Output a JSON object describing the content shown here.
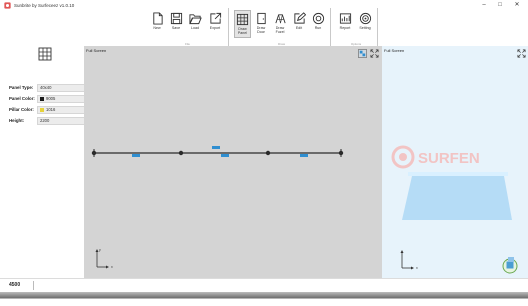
{
  "window": {
    "title": "Sunbrite by Surfeceez v1.0.10"
  },
  "ribbon": {
    "groups": [
      {
        "caption": "File",
        "buttons": [
          {
            "label": "New",
            "icon": "new-file-icon"
          },
          {
            "label": "Save",
            "icon": "save-icon"
          },
          {
            "label": "Load",
            "icon": "folder-open-icon"
          },
          {
            "label": "Export",
            "icon": "export-icon"
          }
        ]
      },
      {
        "caption": "Draw",
        "buttons": [
          {
            "label": "Draw Panel",
            "icon": "grid-panel-icon",
            "active": true
          },
          {
            "label": "Draw Door",
            "icon": "door-icon"
          },
          {
            "label": "Draw Fuzel",
            "icon": "fuzel-icon"
          },
          {
            "label": "Edit",
            "icon": "edit-icon"
          },
          {
            "label": "Run",
            "icon": "run-icon"
          }
        ]
      },
      {
        "caption": "Options",
        "buttons": [
          {
            "label": "Report",
            "icon": "report-icon"
          },
          {
            "label": "Setting",
            "icon": "settings-icon"
          }
        ]
      }
    ]
  },
  "properties": {
    "panel_type": {
      "label": "Panel Type:",
      "value": "40x40"
    },
    "panel_color": {
      "label": "Panel Color:",
      "value": "9005",
      "swatch": "#1a1a1a"
    },
    "pillar_color": {
      "label": "Pillar Color:",
      "value": "1016",
      "swatch": "#e6d23a"
    },
    "height": {
      "label": "Height:",
      "value": "2200"
    }
  },
  "main_view": {
    "header": "Full Screen"
  },
  "view_3d": {
    "header": "Full Screen",
    "watermark": "SURFEN"
  },
  "status": {
    "value": "4500"
  },
  "colors": {
    "plan_background": "#d4d4d4",
    "wall_line": "#2a2a2a",
    "panel_marker": "#2f8ed0",
    "model_blue": "#9fd0f2",
    "axis_green": "#6aa84f"
  }
}
